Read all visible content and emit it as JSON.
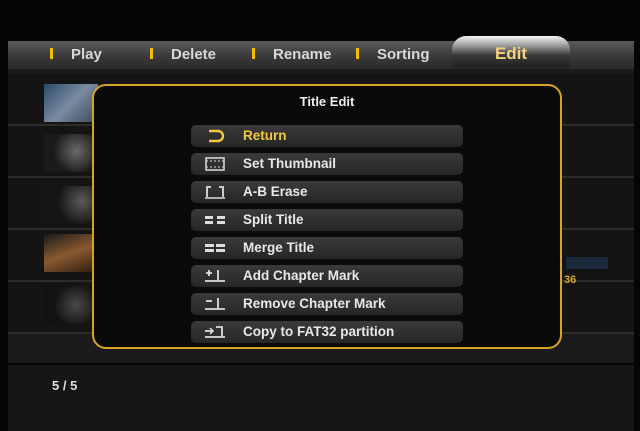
{
  "menubar": {
    "items": [
      {
        "label": "Play"
      },
      {
        "label": "Delete"
      },
      {
        "label": "Rename"
      },
      {
        "label": "Sorting"
      }
    ],
    "active": {
      "label": "Edit"
    }
  },
  "dialog": {
    "title": "Title Edit",
    "options": [
      {
        "label": "Return",
        "icon": "return-icon",
        "selected": true
      },
      {
        "label": "Set Thumbnail",
        "icon": "filmstrip-icon"
      },
      {
        "label": "A-B Erase",
        "icon": "ab-erase-icon"
      },
      {
        "label": "Split Title",
        "icon": "split-icon"
      },
      {
        "label": "Merge Title",
        "icon": "merge-icon"
      },
      {
        "label": "Add Chapter Mark",
        "icon": "add-chapter-icon"
      },
      {
        "label": "Remove Chapter Mark",
        "icon": "remove-chapter-icon"
      },
      {
        "label": "Copy to FAT32 partition",
        "icon": "copy-partition-icon"
      }
    ]
  },
  "list": {
    "right_text": "36"
  },
  "status": {
    "page_count": "5 / 5"
  },
  "colors": {
    "accent": "#d6a324",
    "selected_text": "#f2c744",
    "menu_separator": "#f0c000"
  }
}
